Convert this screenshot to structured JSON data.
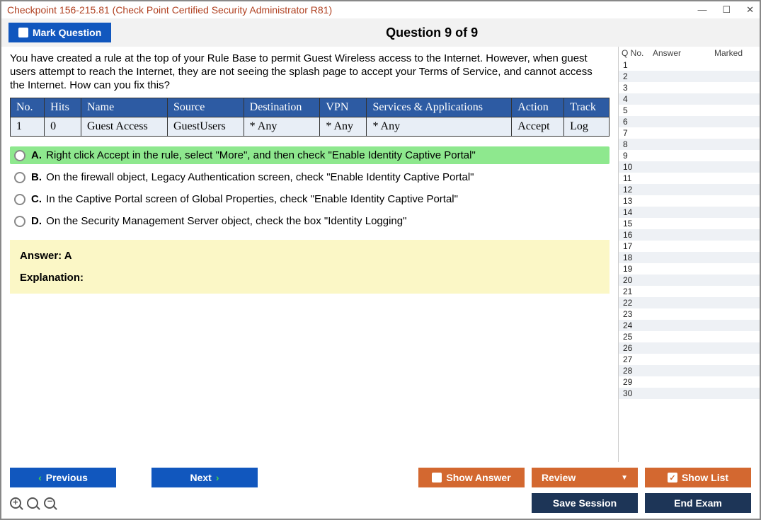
{
  "window": {
    "title": "Checkpoint 156-215.81 (Check Point Certified Security Administrator R81)"
  },
  "topbar": {
    "mark_label": "Mark Question",
    "question_header": "Question 9 of 9"
  },
  "question": {
    "text": "You have created a rule at the top of your Rule Base to permit Guest Wireless access to the Internet. However, when guest users attempt to reach the Internet, they are not seeing the splash page to accept your Terms of Service, and cannot access the Internet. How can you fix this?",
    "table": {
      "headers": [
        "No.",
        "Hits",
        "Name",
        "Source",
        "Destination",
        "VPN",
        "Services & Applications",
        "Action",
        "Track"
      ],
      "row": [
        "1",
        "0",
        "Guest Access",
        "GuestUsers",
        "* Any",
        "* Any",
        "* Any",
        "Accept",
        "Log"
      ]
    },
    "options": [
      {
        "letter": "A.",
        "text": "Right click Accept in the rule, select \"More\", and then check \"Enable Identity Captive Portal\"",
        "correct": true
      },
      {
        "letter": "B.",
        "text": "On the firewall object, Legacy Authentication screen, check \"Enable Identity Captive Portal\"",
        "correct": false
      },
      {
        "letter": "C.",
        "text": "In the Captive Portal screen of Global Properties, check \"Enable Identity Captive Portal\"",
        "correct": false
      },
      {
        "letter": "D.",
        "text": "On the Security Management Server object, check the box \"Identity Logging\"",
        "correct": false
      }
    ],
    "answer_label": "Answer: A",
    "explanation_label": "Explanation:"
  },
  "sidebar": {
    "h1": "Q No.",
    "h2": "Answer",
    "h3": "Marked",
    "row_count": 30
  },
  "buttons": {
    "previous": "Previous",
    "next": "Next",
    "show_answer": "Show Answer",
    "review": "Review",
    "show_list": "Show List",
    "save_session": "Save Session",
    "end_exam": "End Exam"
  }
}
